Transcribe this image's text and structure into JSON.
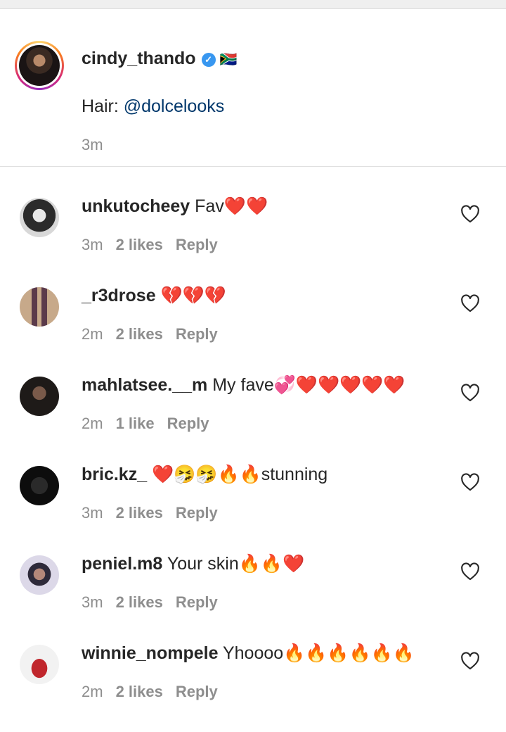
{
  "caption": {
    "username": "cindy_thando",
    "extra_emoji": "🇿🇦",
    "text_prefix": "Hair: ",
    "mention": "@dolcelooks",
    "time": "3m"
  },
  "comments": [
    {
      "username": "unkutocheey",
      "text": " Fav❤️❤️",
      "time": "3m",
      "likes": "2 likes",
      "reply": "Reply"
    },
    {
      "username": "_r3drose",
      "text": " 💔💔💔",
      "time": "2m",
      "likes": "2 likes",
      "reply": "Reply"
    },
    {
      "username": "mahlatsee.__m",
      "text": " My fave💞❤️❤️❤️❤️❤️",
      "time": "2m",
      "likes": "1 like",
      "reply": "Reply"
    },
    {
      "username": "bric.kz_",
      "text": " ❤️🤧🤧🔥🔥stunning",
      "time": "3m",
      "likes": "2 likes",
      "reply": "Reply"
    },
    {
      "username": "peniel.m8",
      "text": " Your skin🔥🔥❤️",
      "time": "3m",
      "likes": "2 likes",
      "reply": "Reply"
    },
    {
      "username": "winnie_nompele",
      "text": " Yhoooo🔥🔥🔥🔥🔥🔥",
      "time": "2m",
      "likes": "2 likes",
      "reply": "Reply"
    }
  ],
  "icons": {
    "like": "heart-outline-icon",
    "verified": "verified-badge-icon"
  },
  "colors": {
    "mention": "#00376b",
    "verified": "#3897f0",
    "meta": "#8e8e8e"
  }
}
